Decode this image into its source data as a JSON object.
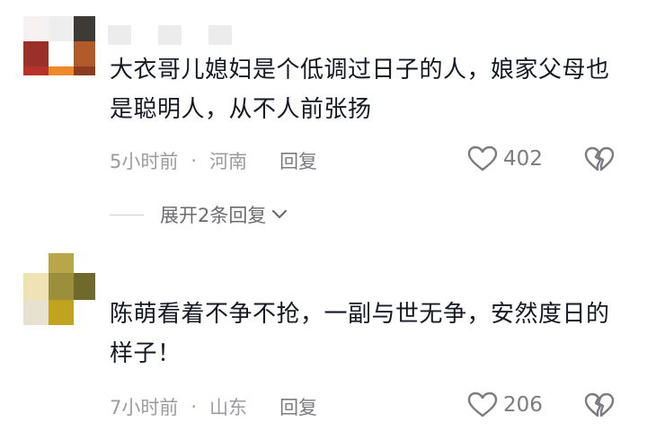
{
  "comments": [
    {
      "text": "大衣哥儿媳妇是个低调过日子的人，娘家父母也是聪明人，从不人前张扬",
      "time": "5小时前",
      "separator": "·",
      "location": "河南",
      "reply_label": "回复",
      "likes": "402",
      "expand_label": "展开2条回复"
    },
    {
      "text": "陈萌看着不争不抢，一副与世无争，安然度日的样子！",
      "time": "7小时前",
      "separator": "·",
      "location": "山东",
      "reply_label": "回复",
      "likes": "206"
    }
  ],
  "icons": {
    "like": "heart-outline-icon",
    "dislike": "broken-heart-icon",
    "expand": "chevron-down-icon"
  },
  "colors": {
    "text": "#161823",
    "meta": "#9b9ba1",
    "icon": "#7b7b80"
  }
}
